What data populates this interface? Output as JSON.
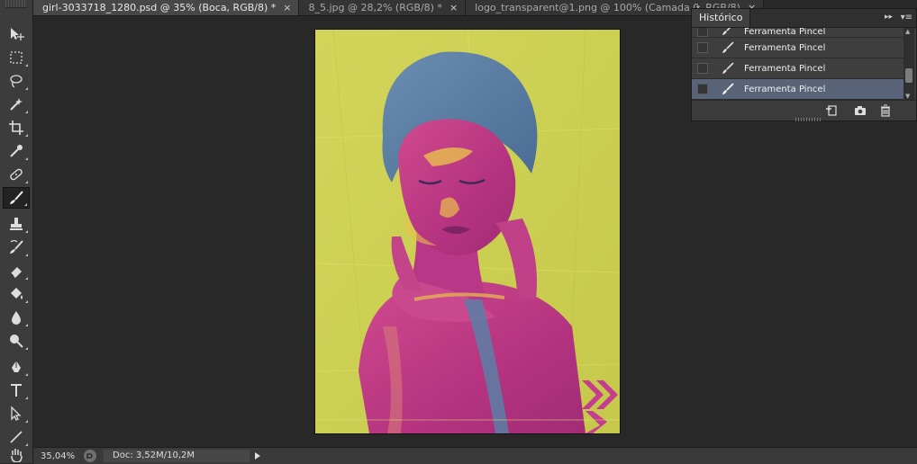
{
  "tabs": [
    {
      "label": "girl-3033718_1280.psd @ 35% (Boca, RGB/8) *",
      "close": "×",
      "active": true
    },
    {
      "label": "8_5.jpg @ 28,2% (RGB/8) *",
      "close": "×",
      "active": false
    },
    {
      "label": "logo_transparent@1.png @ 100% (Camada 0, RGB/8)",
      "close": "×",
      "active": false
    }
  ],
  "tab_overflow": "⌄",
  "history": {
    "title": "Histórico",
    "collapse": "▸▸",
    "menu": "▾≡",
    "items": [
      {
        "label": "Ferramenta Pincel",
        "selected": false
      },
      {
        "label": "Ferramenta Pincel",
        "selected": false
      },
      {
        "label": "Ferramenta Pincel",
        "selected": false
      },
      {
        "label": "Ferramenta Pincel",
        "selected": true
      }
    ],
    "footer_icons": [
      "new-document-from-state-icon",
      "camera-snapshot-icon",
      "trash-icon"
    ]
  },
  "status": {
    "zoom": "35,04%",
    "doc": "Doc: 3,52M/10,2M"
  },
  "tools": [
    "move-tool-icon",
    "marquee-tool-icon",
    "lasso-tool-icon",
    "magic-wand-icon",
    "crop-tool-icon",
    "eyedropper-icon",
    "healing-brush-icon",
    "brush-tool-icon",
    "clone-stamp-icon",
    "history-brush-icon",
    "eraser-icon",
    "paint-bucket-icon",
    "blur-tool-icon",
    "dodge-tool-icon",
    "pen-tool-icon",
    "type-tool-icon",
    "path-selection-icon",
    "line-tool-icon",
    "hand-tool-icon"
  ],
  "colors": {
    "poster_background": "#cfd153",
    "face_magenta": "#c23a86",
    "hair_blue": "#5a80a0",
    "highlight_yellow": "#e7c048",
    "chevron_magenta": "#c43d8e"
  }
}
